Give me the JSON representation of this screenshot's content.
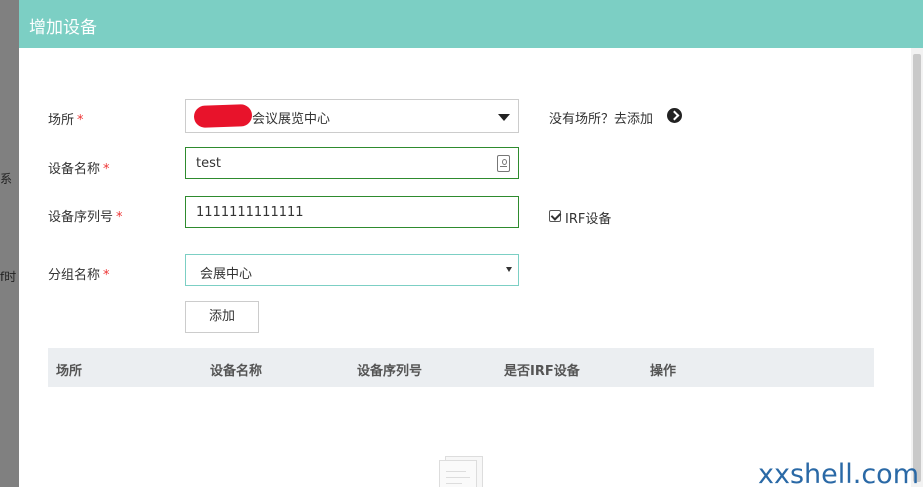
{
  "background": {
    "text_a": "系",
    "text_b": "f时"
  },
  "modal": {
    "title": "增加设备"
  },
  "form": {
    "venue": {
      "label": "场所",
      "required": "*",
      "value": "会议展览中心"
    },
    "add_venue_link": "没有场所？去添加",
    "device_name": {
      "label": "设备名称",
      "required": "*",
      "value": "test"
    },
    "serial": {
      "label": "设备序列号",
      "required": "*",
      "value": "1111111111111"
    },
    "irf": {
      "label": "IRF设备",
      "checked": true
    },
    "group": {
      "label": "分组名称",
      "required": "*",
      "value": "会展中心"
    },
    "add_button": "添加"
  },
  "table": {
    "columns": [
      "场所",
      "设备名称",
      "设备序列号",
      "是否IRF设备",
      "操作"
    ]
  },
  "watermark": "xxshell.com",
  "colors": {
    "header": "#7ccfc4",
    "valid_border": "#2e8b2e",
    "required": "#ee3333"
  }
}
